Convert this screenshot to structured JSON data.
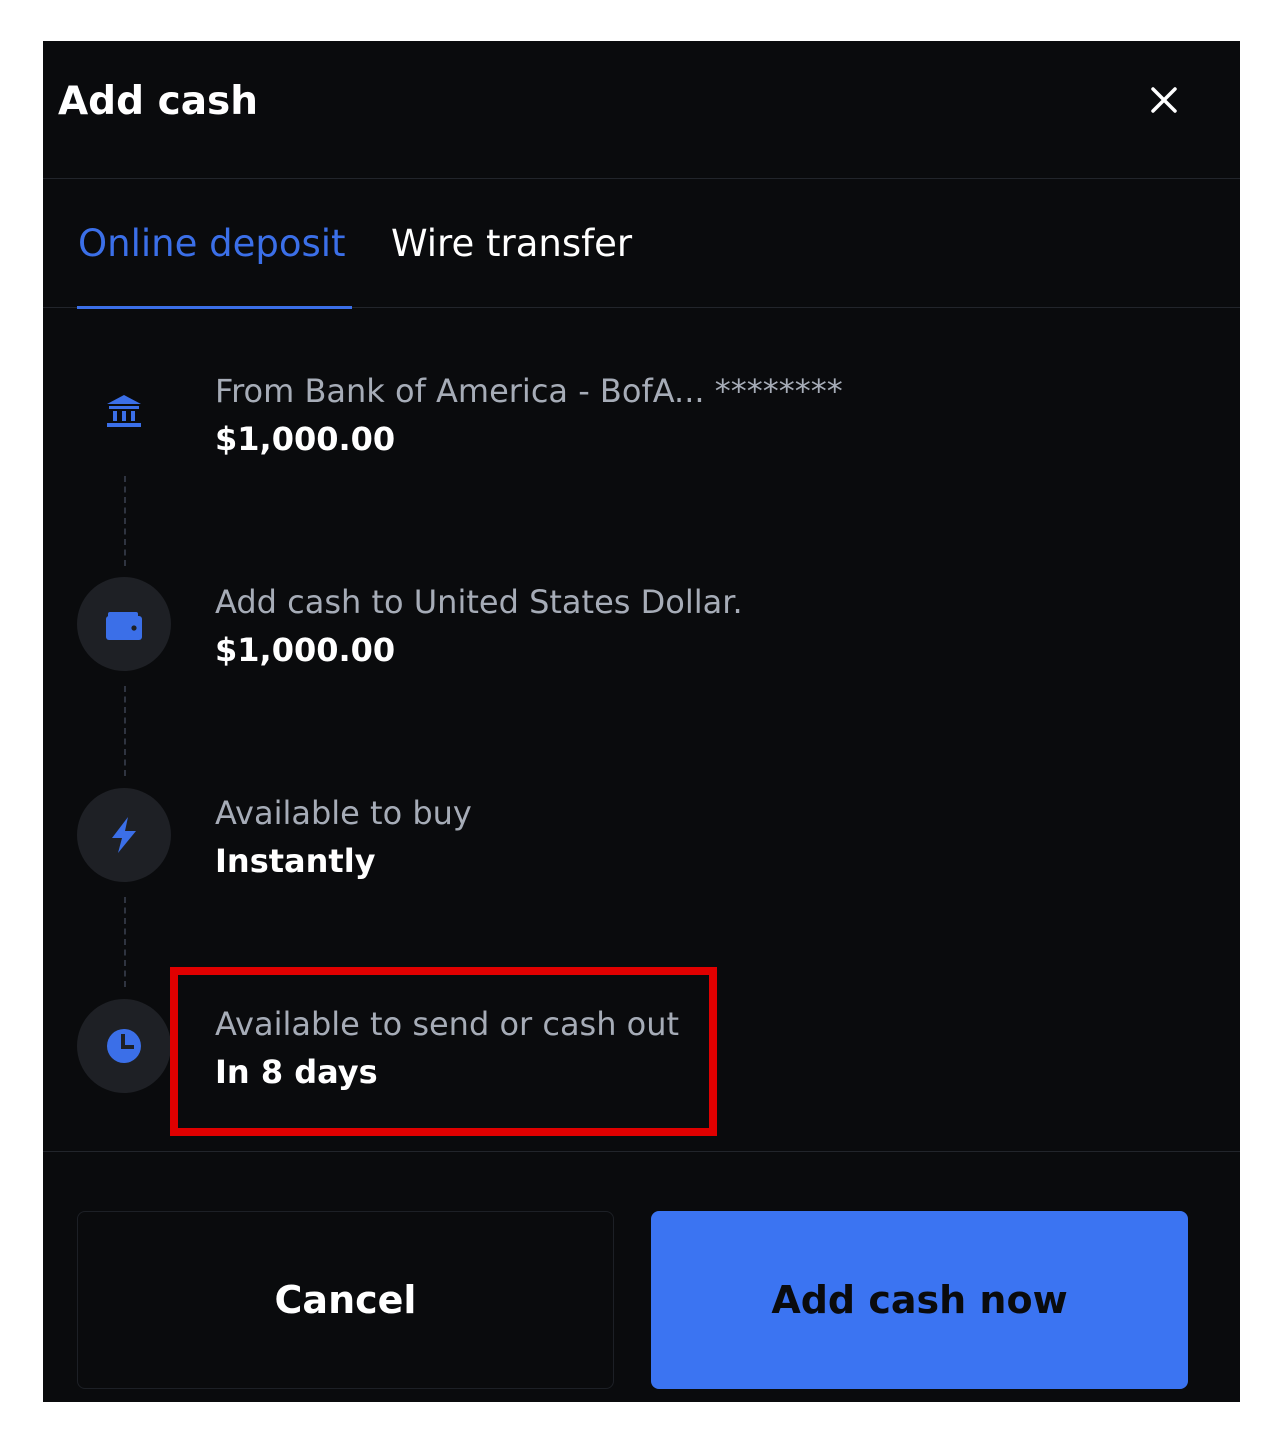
{
  "modal": {
    "title": "Add cash",
    "close_icon": "close-icon"
  },
  "tabs": [
    {
      "label": "Online deposit",
      "active": true
    },
    {
      "label": "Wire transfer",
      "active": false
    }
  ],
  "steps": [
    {
      "icon": "bank-icon",
      "label": "From Bank of America - BofA... ********",
      "value": "$1,000.00"
    },
    {
      "icon": "wallet-icon",
      "label": "Add cash to United States Dollar.",
      "value": "$1,000.00"
    },
    {
      "icon": "lightning-icon",
      "label": "Available to buy",
      "value": "Instantly"
    },
    {
      "icon": "clock-icon",
      "label": "Available to send or cash out",
      "value": "In 8 days"
    }
  ],
  "footer": {
    "cancel_label": "Cancel",
    "confirm_label": "Add cash now"
  },
  "colors": {
    "accent": "#3b6fe8",
    "background": "#0a0b0d",
    "highlight": "#e00000"
  }
}
